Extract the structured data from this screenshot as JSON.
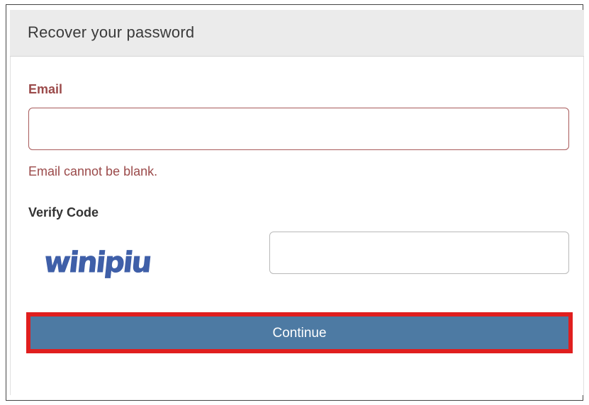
{
  "panel": {
    "title": "Recover your password"
  },
  "form": {
    "email_label": "Email",
    "email_value": "",
    "email_error": "Email cannot be blank.",
    "verify_label": "Verify Code",
    "captcha_text": "winipiu",
    "verify_value": "",
    "submit_label": "Continue"
  },
  "colors": {
    "error": "#9b4a4a",
    "button": "#4d7aa3",
    "highlight_outline": "#e01e1e",
    "captcha": "#3f5fa8"
  }
}
